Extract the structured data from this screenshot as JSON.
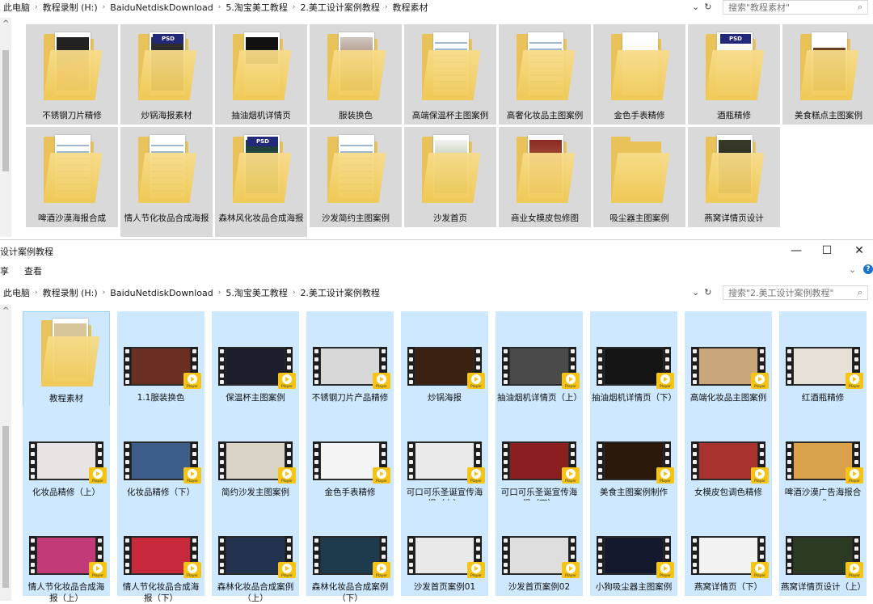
{
  "top_window": {
    "breadcrumb": [
      "此电脑",
      "教程录制 (H:)",
      "BaiduNetdiskDownload",
      "5.淘宝美工教程",
      "2.美工设计案例教程",
      "教程素材"
    ],
    "search_placeholder": "搜索\"教程素材\"",
    "folders": [
      {
        "label": "不锈钢刀片精修",
        "style": "knife"
      },
      {
        "label": "炒锅海报素材",
        "style": "psd-wok"
      },
      {
        "label": "抽油烟机详情页",
        "style": "hood"
      },
      {
        "label": "服装换色",
        "style": "coat"
      },
      {
        "label": "高端保温杯主图案例",
        "style": "doc"
      },
      {
        "label": "高奢化妆品主图案例",
        "style": "doc"
      },
      {
        "label": "金色手表精修",
        "style": "white"
      },
      {
        "label": "酒瓶精修",
        "style": "psd-wine"
      },
      {
        "label": "美食糕点主图案例",
        "style": "food"
      },
      {
        "label": "啤酒沙漠海报合成",
        "style": "doc"
      },
      {
        "label": "情人节化妆品合成海报",
        "style": "doc"
      },
      {
        "label": "森林风化妆品合成海报",
        "style": "psd-forest"
      },
      {
        "label": "沙发简约主图案例",
        "style": "doc"
      },
      {
        "label": "沙发首页",
        "style": "plant"
      },
      {
        "label": "商业女模皮包修图",
        "style": "model"
      },
      {
        "label": "吸尘器主图案例",
        "style": "empty"
      },
      {
        "label": "燕窝详情页设计",
        "style": "dark"
      }
    ]
  },
  "bottom_window": {
    "title": "设计案例教程",
    "ribbon_left": "享",
    "ribbon_view": "查看",
    "minimize": "—",
    "maximize": "☐",
    "close": "✕",
    "help": "?",
    "breadcrumb": [
      "此电脑",
      "教程录制 (H:)",
      "BaiduNetdiskDownload",
      "5.淘宝美工教程",
      "2.美工设计案例教程"
    ],
    "search_placeholder": "搜索\"2.美工设计案例教程\"",
    "player_badge": "Player",
    "items": [
      {
        "label": "教程素材",
        "kind": "folder",
        "thumb": "#d9c59a"
      },
      {
        "label": "1.1服装换色",
        "kind": "video",
        "thumb": "#6b2f22"
      },
      {
        "label": "保温杯主图案例",
        "kind": "video",
        "thumb": "#1a1d2a"
      },
      {
        "label": "不锈钢刀片产品精修",
        "kind": "video",
        "thumb": "#d8d8d8"
      },
      {
        "label": "炒锅海报",
        "kind": "video",
        "thumb": "#3a2110"
      },
      {
        "label": "抽油烟机详情页（上）",
        "kind": "video",
        "thumb": "#4a4a4a"
      },
      {
        "label": "抽油烟机详情页（下）",
        "kind": "video",
        "thumb": "#151515"
      },
      {
        "label": "高端化妆品主图案例",
        "kind": "video",
        "thumb": "#c9a77a"
      },
      {
        "label": "红酒瓶精修",
        "kind": "video",
        "thumb": "#e6e0d6"
      },
      {
        "label": "化妆品精修（上）",
        "kind": "video",
        "thumb": "#e8e4e4"
      },
      {
        "label": "化妆品精修（下）",
        "kind": "video",
        "thumb": "#3d5e8a"
      },
      {
        "label": "简约沙发主图案例",
        "kind": "video",
        "thumb": "#d9d4c6"
      },
      {
        "label": "金色手表精修",
        "kind": "video",
        "thumb": "#f4f4f4"
      },
      {
        "label": "可口可乐圣诞宣传海报（上）",
        "kind": "video",
        "thumb": "#eaeaea"
      },
      {
        "label": "可口可乐圣诞宣传海报（下）",
        "kind": "video",
        "thumb": "#8a1f1f"
      },
      {
        "label": "美食主图案例制作",
        "kind": "video",
        "thumb": "#2b1a0c"
      },
      {
        "label": "女模皮包调色精修",
        "kind": "video",
        "thumb": "#a8322c"
      },
      {
        "label": "啤酒沙漠广告海报合成",
        "kind": "video",
        "thumb": "#d9a24a"
      },
      {
        "label": "情人节化妆品合成海报（上）",
        "kind": "video",
        "thumb": "#c23a78"
      },
      {
        "label": "情人节化妆品合成海报（下）",
        "kind": "video",
        "thumb": "#c7283a"
      },
      {
        "label": "森林化妆品合成案例（上）",
        "kind": "video",
        "thumb": "#22324f"
      },
      {
        "label": "森林化妆品合成案例（下）",
        "kind": "video",
        "thumb": "#1d3b4d"
      },
      {
        "label": "沙发首页案例01",
        "kind": "video",
        "thumb": "#e9e9e9"
      },
      {
        "label": "沙发首页案例02",
        "kind": "video",
        "thumb": "#dedede"
      },
      {
        "label": "小狗吸尘器主图案例",
        "kind": "video",
        "thumb": "#14192e"
      },
      {
        "label": "燕窝详情页（下）",
        "kind": "video",
        "thumb": "#f2f2f2"
      },
      {
        "label": "燕窝详情页设计（上）",
        "kind": "video",
        "thumb": "#2d3a23"
      }
    ]
  }
}
